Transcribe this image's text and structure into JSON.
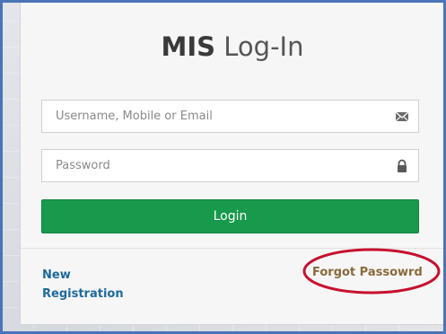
{
  "login": {
    "title_bold": "MIS",
    "title_light": "Log-In",
    "username_placeholder": "Username, Mobile or Email",
    "password_placeholder": "Password",
    "login_label": "Login",
    "new_registration_label": "New Registration",
    "forgot_password_label": "Forgot Passowrd"
  },
  "icons": {
    "username_field": "envelope-icon",
    "password_field": "lock-icon"
  },
  "colors": {
    "login_button": "#189a4c",
    "new_registration_link": "#1e6a9c",
    "forgot_password_link": "#8a6a3b",
    "annotation": "#c8102e",
    "frame_border": "#4a74b8"
  }
}
